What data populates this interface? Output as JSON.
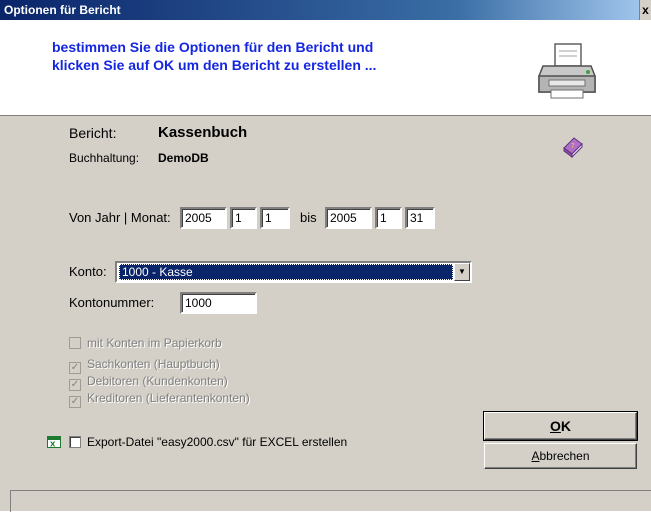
{
  "window": {
    "title": "Optionen für Bericht",
    "close": "x"
  },
  "header": {
    "line1": "bestimmen Sie die Optionen für den Bericht und",
    "line2": "klicken Sie auf OK um den Bericht zu erstellen ...",
    "icon": "printer-icon",
    "text_color": "#1526e0"
  },
  "report": {
    "bericht_label": "Bericht:",
    "bericht_value": "Kassenbuch",
    "buch_label": "Buchhaltung:",
    "buch_value": "DemoDB",
    "icon": "book-icon"
  },
  "period": {
    "label": "Von Jahr | Monat:",
    "from_year": "2005",
    "from_month": "1",
    "from_day": "1",
    "bis_label": "bis",
    "to_year": "2005",
    "to_month": "1",
    "to_day": "31"
  },
  "konto": {
    "label": "Konto:",
    "selected": "1000 - Kasse",
    "nummer_label": "Kontonummer:",
    "nummer_value": "1000"
  },
  "checkboxes": [
    {
      "label": "mit Konten im Papierkorb",
      "checked": false,
      "enabled": false
    },
    {
      "label": "Sachkonten (Hauptbuch)",
      "checked": true,
      "enabled": false
    },
    {
      "label": "Debitoren (Kundenkonten)",
      "checked": true,
      "enabled": false
    },
    {
      "label": "Kreditoren (Lieferantenkonten)",
      "checked": true,
      "enabled": false
    }
  ],
  "export": {
    "label": "Export-Datei \"easy2000.csv\" für EXCEL erstellen",
    "checked": false,
    "icon": "excel-icon"
  },
  "buttons": {
    "ok_mnemonic": "O",
    "ok_rest": "K",
    "cancel_mnemonic": "A",
    "cancel_rest": "bbrechen"
  },
  "colors": {
    "title_bar": "#0a246a",
    "dialog_face": "#d4d0c8",
    "selection": "#0a246a"
  }
}
